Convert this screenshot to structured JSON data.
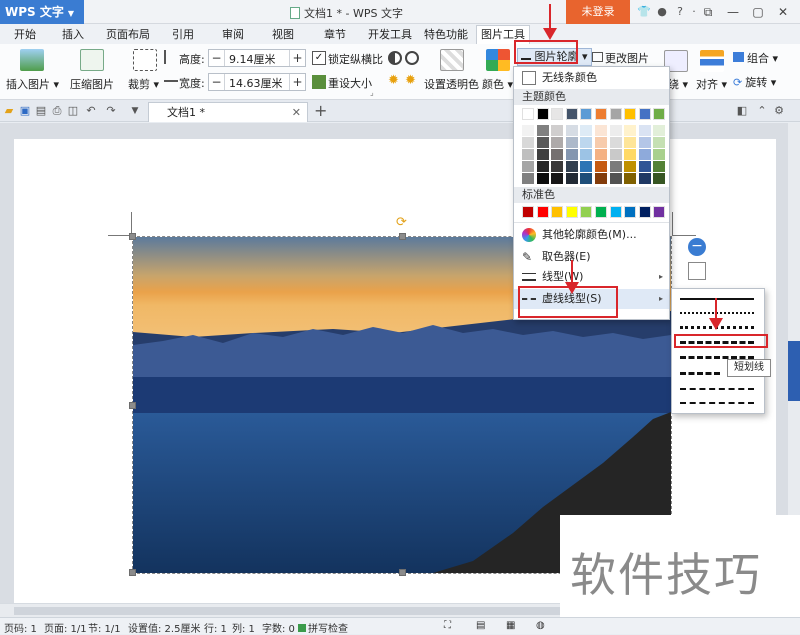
{
  "titlebar": {
    "app_name": "WPS 文字",
    "doc_title": "文档1 * - WPS 文字",
    "login": "未登录"
  },
  "menu": {
    "tabs": [
      "开始",
      "插入",
      "页面布局",
      "引用",
      "审阅",
      "视图",
      "章节",
      "开发工具",
      "特色功能",
      "图片工具"
    ],
    "active_tab": "图片工具"
  },
  "ribbon": {
    "insert_picture": "插入图片",
    "compress_picture": "压缩图片",
    "crop": "裁剪",
    "height_label": "高度:",
    "height_value": "9.14厘米",
    "width_label": "宽度:",
    "width_value": "14.63厘米",
    "lock_ratio": "锁定纵横比",
    "reset_size": "重设大小",
    "set_transparent": "设置透明色",
    "color": "颜色",
    "picture_outline": "图片轮廓",
    "change_picture": "更改图片",
    "group": "组合",
    "align": "对齐",
    "rotate": "旋转",
    "wrap": "绕"
  },
  "doc_tab": {
    "label": "文档1 *"
  },
  "outline_menu": {
    "no_outline": "无线条颜色",
    "theme_colors_header": "主题颜色",
    "standard_colors_header": "标准色",
    "more_colors": "其他轮廓颜色(M)...",
    "eyedropper": "取色器(E)",
    "line_style": "线型(W)",
    "dash_style": "虚线线型(S)",
    "theme_top_row": [
      "#ffffff",
      "#000000",
      "#e7e6e6",
      "#44546a",
      "#5b9bd5",
      "#ed7d31",
      "#a5a5a5",
      "#ffc000",
      "#4472c4",
      "#70ad47"
    ],
    "theme_shades": [
      [
        "#f2f2f2",
        "#808080",
        "#d0cece",
        "#d6dce4",
        "#deebf6",
        "#fbe5d5",
        "#ededed",
        "#fff2cc",
        "#dae3f3",
        "#e2efd9"
      ],
      [
        "#d8d8d8",
        "#595959",
        "#aeaaaa",
        "#adb9ca",
        "#bdd7ee",
        "#f7cbac",
        "#dbdbdb",
        "#fee599",
        "#b4c6e7",
        "#c5e0b3"
      ],
      [
        "#bfbfbf",
        "#3f3f3f",
        "#757070",
        "#8496b0",
        "#9cc3e5",
        "#f4b183",
        "#c9c9c9",
        "#ffd965",
        "#8eaadb",
        "#a8d08d"
      ],
      [
        "#a5a5a5",
        "#262626",
        "#3a3838",
        "#323f4f",
        "#2e75b5",
        "#c55a11",
        "#7b7b7b",
        "#bf9000",
        "#2f5496",
        "#538135"
      ],
      [
        "#7f7f7f",
        "#0c0c0c",
        "#171616",
        "#222a35",
        "#1e4e79",
        "#833c0b",
        "#525252",
        "#7f6000",
        "#1f3864",
        "#375623"
      ]
    ],
    "standard": [
      "#c00000",
      "#ff0000",
      "#ffc000",
      "#ffff00",
      "#92d050",
      "#00b050",
      "#00b0f0",
      "#0070c0",
      "#002060",
      "#7030a0"
    ]
  },
  "dash_submenu": {
    "tooltip": "短划线"
  },
  "statusbar": {
    "page_num": "页码: 1",
    "pages": "页面: 1/1",
    "section": "节: 1/1",
    "setting": "设置值: 2.5厘米",
    "row": "行: 1",
    "col": "列: 1",
    "words": "字数: 0",
    "spell": "拼写检查"
  },
  "watermark": "软件技巧",
  "colors": {
    "accent_blue": "#3a7cd2",
    "login_orange": "#e8642e",
    "annotation_red": "#d9262b"
  }
}
